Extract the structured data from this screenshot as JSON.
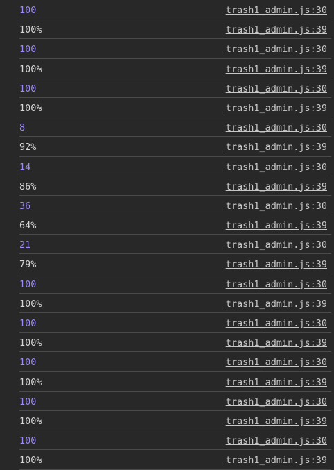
{
  "theme": {
    "background": "#282828",
    "number_color": "#9d8cf2",
    "string_color": "#d7d7d7",
    "link_color": "#c7c7c7",
    "divider_color": "#4a4a4a"
  },
  "console": {
    "rows": [
      {
        "value": "100",
        "kind": "num",
        "source": "trash1_admin.js:30"
      },
      {
        "value": "100%",
        "kind": "str",
        "source": "trash1_admin.js:39"
      },
      {
        "value": "100",
        "kind": "num",
        "source": "trash1_admin.js:30"
      },
      {
        "value": "100%",
        "kind": "str",
        "source": "trash1_admin.js:39"
      },
      {
        "value": "100",
        "kind": "num",
        "source": "trash1_admin.js:30"
      },
      {
        "value": "100%",
        "kind": "str",
        "source": "trash1_admin.js:39"
      },
      {
        "value": "8",
        "kind": "num",
        "source": "trash1_admin.js:30"
      },
      {
        "value": "92%",
        "kind": "str",
        "source": "trash1_admin.js:39"
      },
      {
        "value": "14",
        "kind": "num",
        "source": "trash1_admin.js:30"
      },
      {
        "value": "86%",
        "kind": "str",
        "source": "trash1_admin.js:39"
      },
      {
        "value": "36",
        "kind": "num",
        "source": "trash1_admin.js:30"
      },
      {
        "value": "64%",
        "kind": "str",
        "source": "trash1_admin.js:39"
      },
      {
        "value": "21",
        "kind": "num",
        "source": "trash1_admin.js:30"
      },
      {
        "value": "79%",
        "kind": "str",
        "source": "trash1_admin.js:39"
      },
      {
        "value": "100",
        "kind": "num",
        "source": "trash1_admin.js:30"
      },
      {
        "value": "100%",
        "kind": "str",
        "source": "trash1_admin.js:39"
      },
      {
        "value": "100",
        "kind": "num",
        "source": "trash1_admin.js:30"
      },
      {
        "value": "100%",
        "kind": "str",
        "source": "trash1_admin.js:39"
      },
      {
        "value": "100",
        "kind": "num",
        "source": "trash1_admin.js:30"
      },
      {
        "value": "100%",
        "kind": "str",
        "source": "trash1_admin.js:39"
      },
      {
        "value": "100",
        "kind": "num",
        "source": "trash1_admin.js:30"
      },
      {
        "value": "100%",
        "kind": "str",
        "source": "trash1_admin.js:39"
      },
      {
        "value": "100",
        "kind": "num",
        "source": "trash1_admin.js:30"
      },
      {
        "value": "100%",
        "kind": "str",
        "source": "trash1_admin.js:39"
      }
    ]
  }
}
